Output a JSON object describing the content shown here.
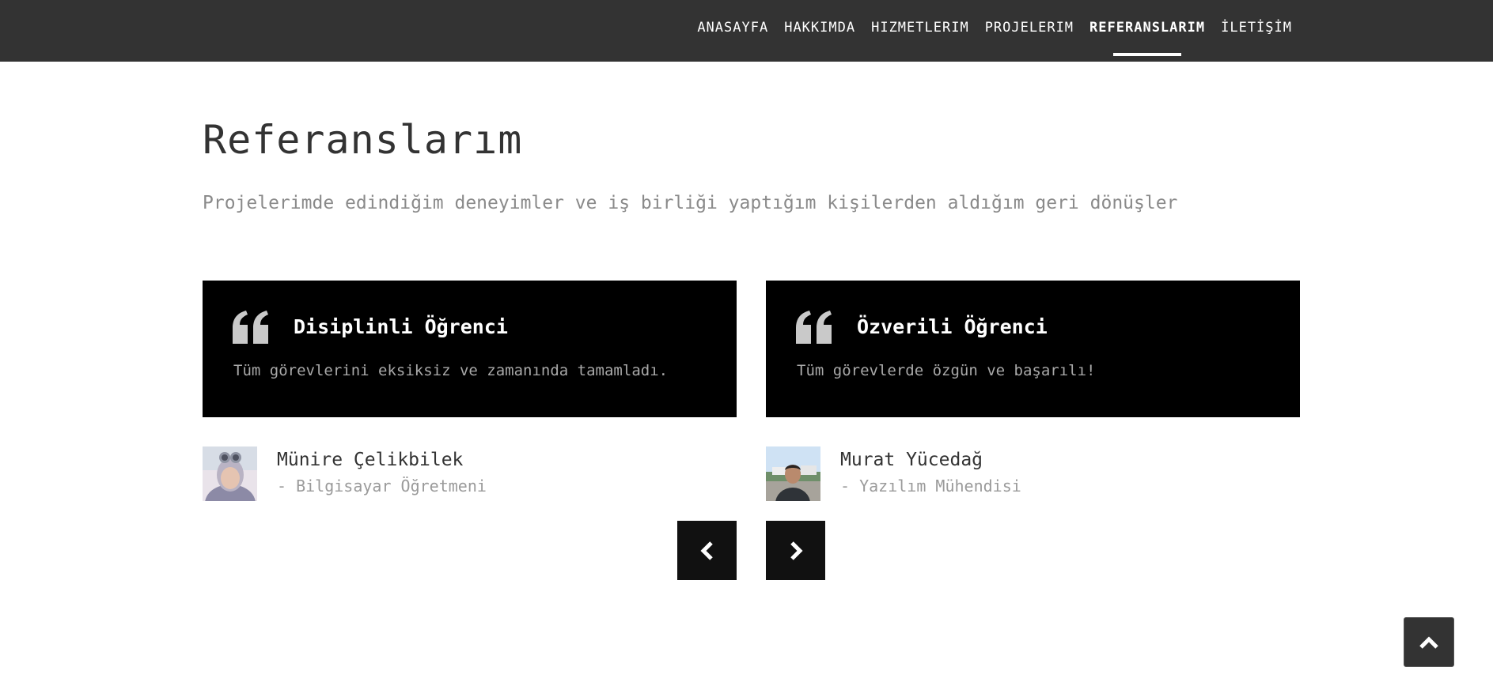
{
  "nav": {
    "items": [
      {
        "label": "ANASAYFA"
      },
      {
        "label": "HAKKIMDA"
      },
      {
        "label": "HIZMETLERIM"
      },
      {
        "label": "PROJELERIM"
      },
      {
        "label": "REFERANSLARIM",
        "active": true
      },
      {
        "label": "İLETİŞİM"
      }
    ]
  },
  "section": {
    "title": "Referanslarım",
    "subtitle": "Projelerimde edindiğim deneyimler ve iş birliği yaptığım kişilerden aldığım geri dönüşler"
  },
  "testimonials": [
    {
      "title": "Disiplinli Öğrenci",
      "text": "Tüm görevlerini eksiksiz ve zamanında tamamladı.",
      "name": "Münire Çelikbilek",
      "role": "- Bilgisayar Öğretmeni"
    },
    {
      "title": "Özverili Öğrenci",
      "text": "Tüm görevlerde özgün ve başarılı!",
      "name": "Murat Yücedağ",
      "role": "- Yazılım Mühendisi"
    }
  ],
  "icons": {
    "quote": "quote-icon",
    "prev": "chevron-left-icon",
    "next": "chevron-right-icon",
    "scroll_top": "chevron-up-icon"
  },
  "colors": {
    "topbar": "#333333",
    "card": "#000000",
    "button": "#111111"
  }
}
